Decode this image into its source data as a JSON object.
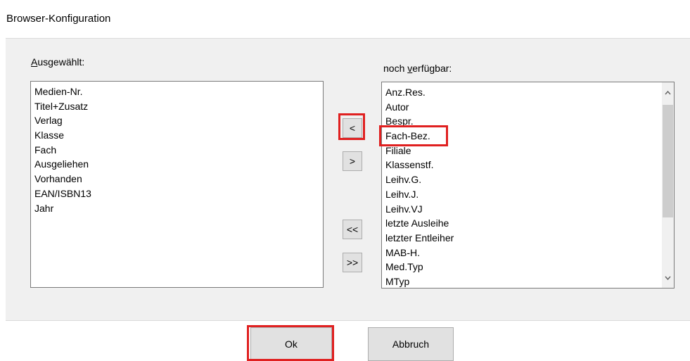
{
  "window": {
    "title": "Browser-Konfiguration"
  },
  "selected_panel": {
    "label_first": "A",
    "label_rest": "usgewählt:",
    "items": [
      "Medien-Nr.",
      "Titel+Zusatz",
      "Verlag",
      "Klasse",
      "Fach",
      "Ausgeliehen",
      "Vorhanden",
      "EAN/ISBN13",
      "Jahr"
    ]
  },
  "available_panel": {
    "label_pre": "noch ",
    "label_accel": "v",
    "label_post": "erfügbar:",
    "items": [
      "Anz.Res.",
      "Autor",
      "Bespr.",
      "Fach-Bez.",
      "Filiale",
      "Klassenstf.",
      "Leihv.G.",
      "Leihv.J.",
      "Leihv.VJ",
      "letzte Ausleihe",
      "letzter Entleiher",
      "MAB-H.",
      "Med.Typ",
      "MTyp"
    ]
  },
  "transfer_buttons": {
    "move_left": "<",
    "move_right": ">",
    "move_all_left": "<<",
    "move_all_right": ">>"
  },
  "footer": {
    "ok_label": "Ok",
    "cancel_label": "Abbruch"
  },
  "colors": {
    "highlight": "#e02020",
    "panel_bg": "#f0f0f0"
  }
}
